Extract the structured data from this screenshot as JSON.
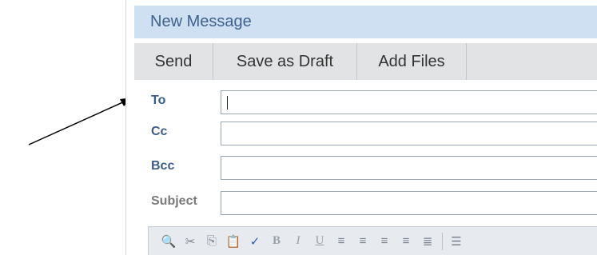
{
  "window": {
    "title": "New Message"
  },
  "toolbar": {
    "send_label": "Send",
    "save_draft_label": "Save as Draft",
    "add_files_label": "Add Files"
  },
  "fields": {
    "to": {
      "label": "To",
      "value": ""
    },
    "cc": {
      "label": "Cc",
      "value": ""
    },
    "bcc": {
      "label": "Bcc",
      "value": ""
    },
    "subject": {
      "label": "Subject",
      "value": ""
    }
  },
  "editor_toolbar": {
    "icons": [
      "find-icon",
      "cut-icon",
      "copy-icon",
      "paste-icon",
      "spellcheck-icon",
      "bold-icon",
      "italic-icon",
      "underline-icon",
      "align-left-icon",
      "align-center-icon",
      "align-right-icon",
      "justify-icon",
      "justify-full-icon",
      "list-icon"
    ],
    "glyphs": {
      "find": "🔍",
      "cut": "✂",
      "copy": "⎘",
      "paste": "📋",
      "spell": "✓",
      "bold": "B",
      "italic": "I",
      "underline": "U",
      "align_left": "≡",
      "align_center": "≡",
      "align_right": "≡",
      "justify": "≡",
      "justify_full": "≣",
      "list": "☰"
    }
  },
  "colors": {
    "titlebar_bg": "#cfe0f3",
    "title_text": "#3f618d",
    "toolbar_bg": "#e2e3e5",
    "label_text": "#3a5e88"
  }
}
